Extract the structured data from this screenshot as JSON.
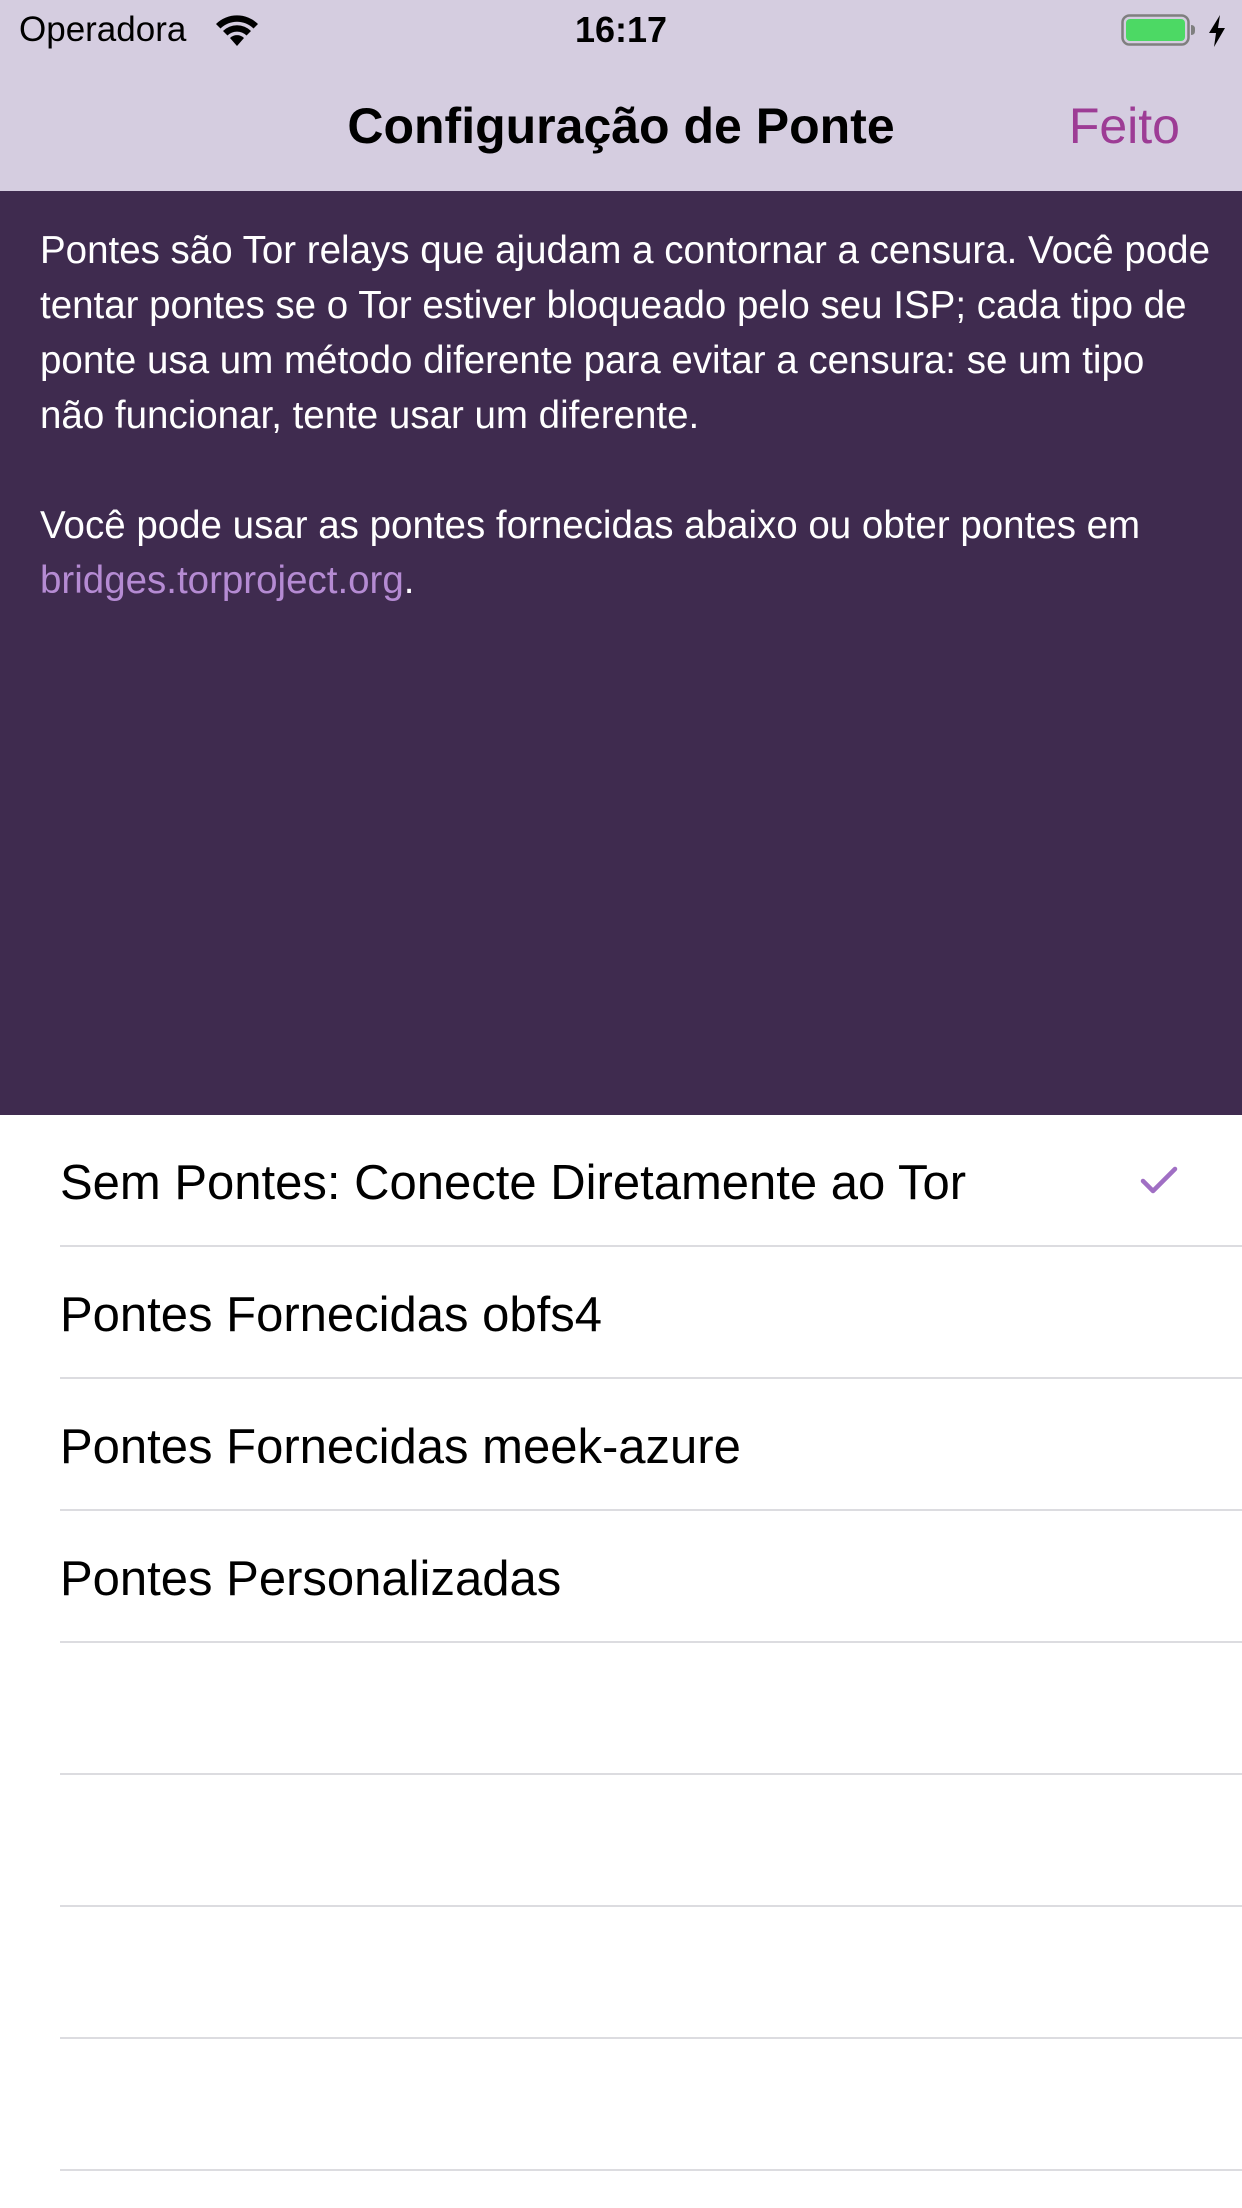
{
  "status_bar": {
    "carrier": "Operadora",
    "time": "16:17",
    "icons": [
      "wifi-icon",
      "battery-icon",
      "charging-bolt-icon"
    ],
    "battery_color": "#4cd964"
  },
  "nav": {
    "title": "Configuração de Ponte",
    "done_label": "Feito"
  },
  "info": {
    "paragraph1": "Pontes são Tor relays que ajudam a contornar a censura. Você pode tentar pontes se o Tor estiver bloqueado pelo seu ISP; cada tipo de ponte usa um método diferente para evitar a censura: se um tipo não funcionar, tente usar um diferente.",
    "paragraph2_prefix": "Você pode usar as pontes fornecidas abaixo ou obter pontes em ",
    "link": "bridges.torproject.org",
    "paragraph2_suffix": "."
  },
  "bridges": {
    "items": [
      {
        "label": "Sem Pontes: Conecte Diretamente ao Tor",
        "selected": true
      },
      {
        "label": "Pontes Fornecidas obfs4",
        "selected": false
      },
      {
        "label": "Pontes Fornecidas meek-azure",
        "selected": false
      },
      {
        "label": "Pontes Personalizadas",
        "selected": false
      }
    ]
  },
  "colors": {
    "bar_background": "#d5cde0",
    "panel_background": "#3f2b4f",
    "accent": "#9d3c95",
    "link": "#b58bd3",
    "checkmark": "#a06fc4"
  }
}
